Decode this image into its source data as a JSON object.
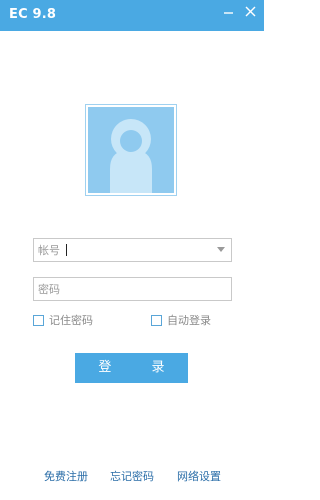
{
  "window": {
    "title": "EC 9.8",
    "minimize_icon": "minimize-icon",
    "close_icon": "close-icon"
  },
  "avatar": {
    "icon": "user-silhouette-icon"
  },
  "account": {
    "placeholder": "帐号",
    "value": ""
  },
  "password": {
    "placeholder": "密码",
    "value": ""
  },
  "options": {
    "remember_label": "记住密码",
    "remember_checked": false,
    "auto_label": "自动登录",
    "auto_checked": false
  },
  "login": {
    "label": "登 录"
  },
  "links": {
    "register": "免费注册",
    "forgot": "忘记密码",
    "network": "网络设置"
  },
  "colors": {
    "accent": "#4aa9e3",
    "avatar_bg": "#8fcaef",
    "avatar_figure": "#c7e6f8",
    "link": "#2b6ea8"
  }
}
